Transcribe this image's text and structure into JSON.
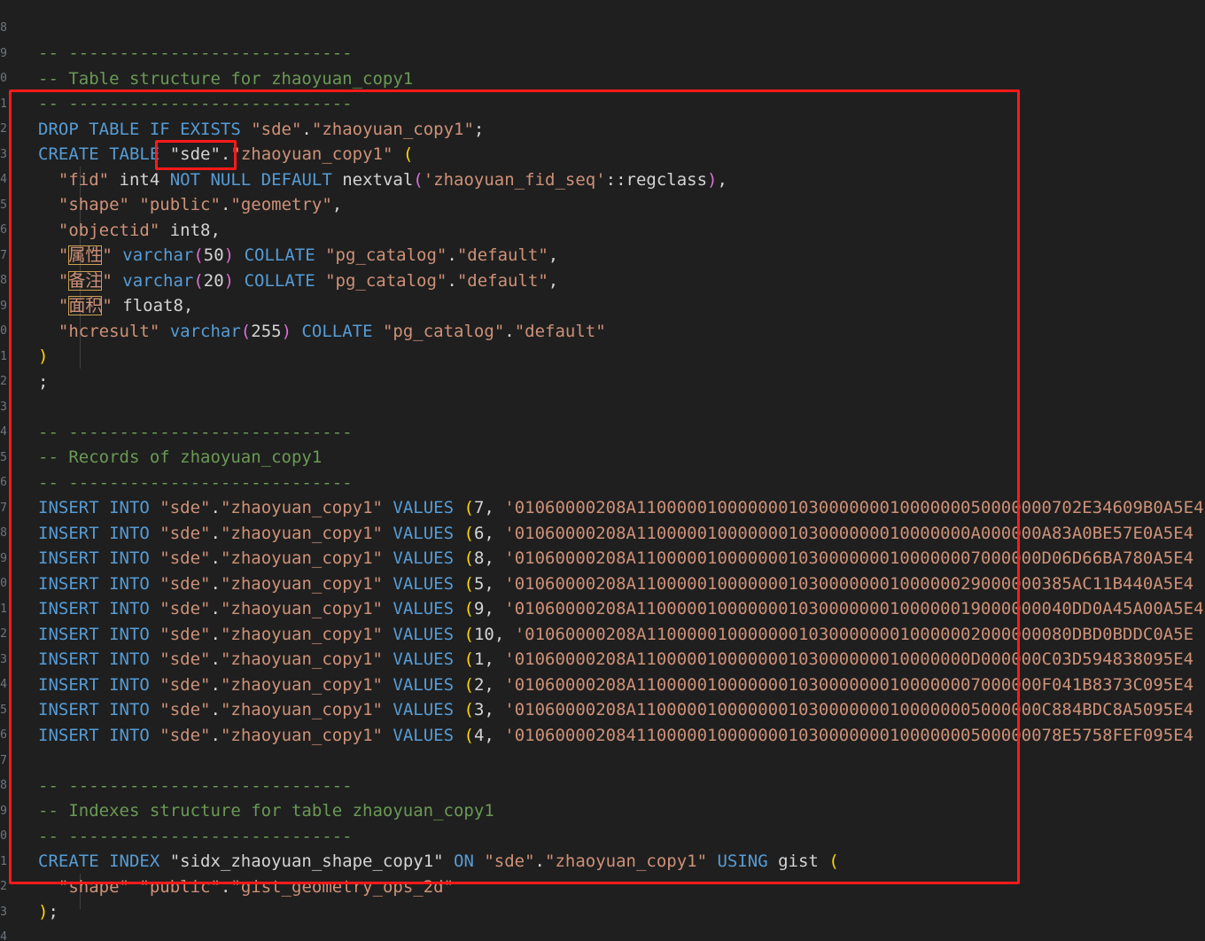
{
  "gutter": {
    "line_numbers": [
      "8",
      "9",
      "0",
      "1",
      "2",
      "3",
      "4",
      "5",
      "6",
      "7",
      "8",
      "9",
      "0",
      "1",
      "2",
      "3",
      "4",
      "5",
      "6",
      "7",
      "8",
      "9",
      "0",
      "1",
      "2",
      "3",
      "4",
      "5",
      "6",
      "7",
      "8",
      "9",
      "0",
      "1",
      "2",
      "3",
      "4"
    ]
  },
  "editor": {
    "lines": [
      [
        {
          "t": "-- ----------------------------",
          "c": "cm"
        }
      ],
      [
        {
          "t": "-- Table structure for zhaoyuan_copy1",
          "c": "cm"
        }
      ],
      [
        {
          "t": "-- ----------------------------",
          "c": "cm"
        }
      ],
      [
        {
          "t": "DROP TABLE IF EXISTS ",
          "c": "kw"
        },
        {
          "t": "\"sde\"",
          "c": "st"
        },
        {
          "t": ".",
          "c": "pu"
        },
        {
          "t": "\"zhaoyuan_copy1\"",
          "c": "st"
        },
        {
          "t": ";",
          "c": "pu"
        }
      ],
      [
        {
          "t": "CREATE TABLE ",
          "c": "kw"
        },
        {
          "t": "\"sde\"",
          "c": "id"
        },
        {
          "t": ".",
          "c": "pu"
        },
        {
          "t": "\"zhaoyuan_copy1\"",
          "c": "st"
        },
        {
          "t": " ",
          "c": "pu"
        },
        {
          "t": "(",
          "c": "br"
        }
      ],
      [
        {
          "t": "  ",
          "c": "pu"
        },
        {
          "t": "\"fid\"",
          "c": "st"
        },
        {
          "t": " int4 ",
          "c": "id"
        },
        {
          "t": "NOT NULL DEFAULT ",
          "c": "kw"
        },
        {
          "t": "nextval",
          "c": "id"
        },
        {
          "t": "(",
          "c": "bm"
        },
        {
          "t": "'zhaoyuan_fid_seq'",
          "c": "st"
        },
        {
          "t": "::regclass",
          "c": "id"
        },
        {
          "t": ")",
          "c": "bm"
        },
        {
          "t": ",",
          "c": "pu"
        }
      ],
      [
        {
          "t": "  ",
          "c": "pu"
        },
        {
          "t": "\"shape\"",
          "c": "st"
        },
        {
          "t": " ",
          "c": "pu"
        },
        {
          "t": "\"public\"",
          "c": "st"
        },
        {
          "t": ".",
          "c": "pu"
        },
        {
          "t": "\"geometry\"",
          "c": "st"
        },
        {
          "t": ",",
          "c": "pu"
        }
      ],
      [
        {
          "t": "  ",
          "c": "pu"
        },
        {
          "t": "\"objectid\"",
          "c": "st"
        },
        {
          "t": " int8,",
          "c": "id"
        }
      ],
      [
        {
          "t": "  ",
          "c": "pu"
        },
        {
          "t": "\"",
          "c": "st"
        },
        {
          "t": "属性",
          "c": "st",
          "w": 1
        },
        {
          "t": "\"",
          "c": "st"
        },
        {
          "t": " varchar",
          "c": "kw"
        },
        {
          "t": "(",
          "c": "bm"
        },
        {
          "t": "50",
          "c": "id"
        },
        {
          "t": ")",
          "c": "bm"
        },
        {
          "t": " COLLATE ",
          "c": "kw"
        },
        {
          "t": "\"pg_catalog\"",
          "c": "st"
        },
        {
          "t": ".",
          "c": "pu"
        },
        {
          "t": "\"default\"",
          "c": "st"
        },
        {
          "t": ",",
          "c": "pu"
        }
      ],
      [
        {
          "t": "  ",
          "c": "pu"
        },
        {
          "t": "\"",
          "c": "st"
        },
        {
          "t": "备注",
          "c": "st",
          "w": 1
        },
        {
          "t": "\"",
          "c": "st"
        },
        {
          "t": " varchar",
          "c": "kw"
        },
        {
          "t": "(",
          "c": "bm"
        },
        {
          "t": "20",
          "c": "id"
        },
        {
          "t": ")",
          "c": "bm"
        },
        {
          "t": " COLLATE ",
          "c": "kw"
        },
        {
          "t": "\"pg_catalog\"",
          "c": "st"
        },
        {
          "t": ".",
          "c": "pu"
        },
        {
          "t": "\"default\"",
          "c": "st"
        },
        {
          "t": ",",
          "c": "pu"
        }
      ],
      [
        {
          "t": "  ",
          "c": "pu"
        },
        {
          "t": "\"",
          "c": "st"
        },
        {
          "t": "面积",
          "c": "st",
          "w": 1
        },
        {
          "t": "\"",
          "c": "st"
        },
        {
          "t": " float8,",
          "c": "id"
        }
      ],
      [
        {
          "t": "  ",
          "c": "pu"
        },
        {
          "t": "\"hcresult\"",
          "c": "st"
        },
        {
          "t": " varchar",
          "c": "kw"
        },
        {
          "t": "(",
          "c": "bm"
        },
        {
          "t": "255",
          "c": "id"
        },
        {
          "t": ")",
          "c": "bm"
        },
        {
          "t": " COLLATE ",
          "c": "kw"
        },
        {
          "t": "\"pg_catalog\"",
          "c": "st"
        },
        {
          "t": ".",
          "c": "pu"
        },
        {
          "t": "\"default\"",
          "c": "st"
        }
      ],
      [
        {
          "t": ")",
          "c": "br"
        }
      ],
      [
        {
          "t": ";",
          "c": "pu"
        }
      ],
      [],
      [
        {
          "t": "-- ----------------------------",
          "c": "cm"
        }
      ],
      [
        {
          "t": "-- Records of zhaoyuan_copy1",
          "c": "cm"
        }
      ],
      [
        {
          "t": "-- ----------------------------",
          "c": "cm"
        }
      ],
      [
        {
          "t": "INSERT INTO ",
          "c": "kw"
        },
        {
          "t": "\"sde\"",
          "c": "st"
        },
        {
          "t": ".",
          "c": "pu"
        },
        {
          "t": "\"zhaoyuan_copy1\"",
          "c": "st"
        },
        {
          "t": " VALUES ",
          "c": "kw"
        },
        {
          "t": "(",
          "c": "br"
        },
        {
          "t": "7, ",
          "c": "id"
        },
        {
          "t": "'01060000208A11000001000000010300000001000000050000000702E34609B0A5E4",
          "c": "st"
        }
      ],
      [
        {
          "t": "INSERT INTO ",
          "c": "kw"
        },
        {
          "t": "\"sde\"",
          "c": "st"
        },
        {
          "t": ".",
          "c": "pu"
        },
        {
          "t": "\"zhaoyuan_copy1\"",
          "c": "st"
        },
        {
          "t": " VALUES ",
          "c": "kw"
        },
        {
          "t": "(",
          "c": "br"
        },
        {
          "t": "6, ",
          "c": "id"
        },
        {
          "t": "'01060000208A110000010000000103000000010000000A000000A83A0BE57E0A5E4",
          "c": "st"
        }
      ],
      [
        {
          "t": "INSERT INTO ",
          "c": "kw"
        },
        {
          "t": "\"sde\"",
          "c": "st"
        },
        {
          "t": ".",
          "c": "pu"
        },
        {
          "t": "\"zhaoyuan_copy1\"",
          "c": "st"
        },
        {
          "t": " VALUES ",
          "c": "kw"
        },
        {
          "t": "(",
          "c": "br"
        },
        {
          "t": "8, ",
          "c": "id"
        },
        {
          "t": "'01060000208A1100000100000001030000000100000007000000D06D66BA780A5E4",
          "c": "st"
        }
      ],
      [
        {
          "t": "INSERT INTO ",
          "c": "kw"
        },
        {
          "t": "\"sde\"",
          "c": "st"
        },
        {
          "t": ".",
          "c": "pu"
        },
        {
          "t": "\"zhaoyuan_copy1\"",
          "c": "st"
        },
        {
          "t": " VALUES ",
          "c": "kw"
        },
        {
          "t": "(",
          "c": "br"
        },
        {
          "t": "5, ",
          "c": "id"
        },
        {
          "t": "'01060000208A1100000100000001030000000100000029000000385AC11B440A5E4",
          "c": "st"
        }
      ],
      [
        {
          "t": "INSERT INTO ",
          "c": "kw"
        },
        {
          "t": "\"sde\"",
          "c": "st"
        },
        {
          "t": ".",
          "c": "pu"
        },
        {
          "t": "\"zhaoyuan_copy1\"",
          "c": "st"
        },
        {
          "t": " VALUES ",
          "c": "kw"
        },
        {
          "t": "(",
          "c": "br"
        },
        {
          "t": "9, ",
          "c": "id"
        },
        {
          "t": "'01060000208A1100000100000001030000000100000019000000040DD0A45A00A5E4",
          "c": "st"
        }
      ],
      [
        {
          "t": "INSERT INTO ",
          "c": "kw"
        },
        {
          "t": "\"sde\"",
          "c": "st"
        },
        {
          "t": ".",
          "c": "pu"
        },
        {
          "t": "\"zhaoyuan_copy1\"",
          "c": "st"
        },
        {
          "t": " VALUES ",
          "c": "kw"
        },
        {
          "t": "(",
          "c": "br"
        },
        {
          "t": "10, ",
          "c": "id"
        },
        {
          "t": "'01060000208A110000010000000103000000010000002000000080DBD0BDDC0A5E",
          "c": "st"
        }
      ],
      [
        {
          "t": "INSERT INTO ",
          "c": "kw"
        },
        {
          "t": "\"sde\"",
          "c": "st"
        },
        {
          "t": ".",
          "c": "pu"
        },
        {
          "t": "\"zhaoyuan_copy1\"",
          "c": "st"
        },
        {
          "t": " VALUES ",
          "c": "kw"
        },
        {
          "t": "(",
          "c": "br"
        },
        {
          "t": "1, ",
          "c": "id"
        },
        {
          "t": "'01060000208A110000010000000103000000010000000D000000C03D594838095E4",
          "c": "st"
        }
      ],
      [
        {
          "t": "INSERT INTO ",
          "c": "kw"
        },
        {
          "t": "\"sde\"",
          "c": "st"
        },
        {
          "t": ".",
          "c": "pu"
        },
        {
          "t": "\"zhaoyuan_copy1\"",
          "c": "st"
        },
        {
          "t": " VALUES ",
          "c": "kw"
        },
        {
          "t": "(",
          "c": "br"
        },
        {
          "t": "2, ",
          "c": "id"
        },
        {
          "t": "'01060000208A1100000100000001030000000100000007000000F041B8373C095E4",
          "c": "st"
        }
      ],
      [
        {
          "t": "INSERT INTO ",
          "c": "kw"
        },
        {
          "t": "\"sde\"",
          "c": "st"
        },
        {
          "t": ".",
          "c": "pu"
        },
        {
          "t": "\"zhaoyuan_copy1\"",
          "c": "st"
        },
        {
          "t": " VALUES ",
          "c": "kw"
        },
        {
          "t": "(",
          "c": "br"
        },
        {
          "t": "3, ",
          "c": "id"
        },
        {
          "t": "'01060000208A1100000100000001030000000100000005000000C884BDC8A5095E4",
          "c": "st"
        }
      ],
      [
        {
          "t": "INSERT INTO ",
          "c": "kw"
        },
        {
          "t": "\"sde\"",
          "c": "st"
        },
        {
          "t": ".",
          "c": "pu"
        },
        {
          "t": "\"zhaoyuan_copy1\"",
          "c": "st"
        },
        {
          "t": " VALUES ",
          "c": "kw"
        },
        {
          "t": "(",
          "c": "br"
        },
        {
          "t": "4, ",
          "c": "id"
        },
        {
          "t": "'010600002084110000010000000103000000010000000500000078E5758FEF095E4",
          "c": "st"
        }
      ],
      [],
      [
        {
          "t": "-- ----------------------------",
          "c": "cm"
        }
      ],
      [
        {
          "t": "-- Indexes structure for table zhaoyuan_copy1",
          "c": "cm"
        }
      ],
      [
        {
          "t": "-- ----------------------------",
          "c": "cm"
        }
      ],
      [
        {
          "t": "CREATE INDEX ",
          "c": "kw"
        },
        {
          "t": "\"sidx_zhaoyuan_shape_copy1\"",
          "c": "id"
        },
        {
          "t": " ON ",
          "c": "kw"
        },
        {
          "t": "\"sde\"",
          "c": "st"
        },
        {
          "t": ".",
          "c": "pu"
        },
        {
          "t": "\"zhaoyuan_copy1\"",
          "c": "st"
        },
        {
          "t": " USING ",
          "c": "kw"
        },
        {
          "t": "gist ",
          "c": "id"
        },
        {
          "t": "(",
          "c": "br"
        }
      ],
      [
        {
          "t": "  ",
          "c": "pu"
        },
        {
          "t": "\"shape\"",
          "c": "st"
        },
        {
          "t": " ",
          "c": "pu"
        },
        {
          "t": "\"public\"",
          "c": "st"
        },
        {
          "t": ".",
          "c": "pu"
        },
        {
          "t": "\"gist_geometry_ops_2d\"",
          "c": "st"
        }
      ],
      [
        {
          "t": ")",
          "c": "br"
        },
        {
          "t": ";",
          "c": "pu"
        }
      ]
    ]
  },
  "annotations": {
    "box_color": "#ff1a1a"
  }
}
